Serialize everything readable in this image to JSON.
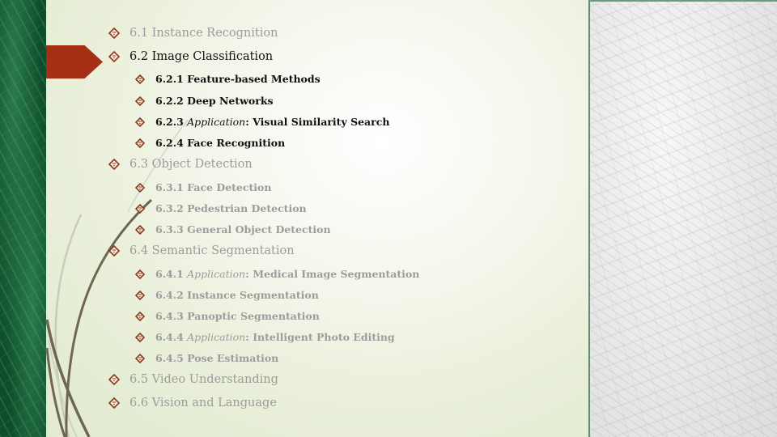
{
  "theme": {
    "accent": "#a52f14",
    "bullet_color": "#8a3a1c",
    "active_text": "#111111",
    "inactive_text": "#9c9c9c",
    "green_strip": "#0d4d2a",
    "curve_color": "#6e6650"
  },
  "outline": [
    {
      "level": 1,
      "number": "6.1",
      "italic": "",
      "text": "Instance Recognition",
      "active": false
    },
    {
      "level": 1,
      "number": "6.2",
      "italic": "",
      "text": "Image Classification",
      "active": true
    },
    {
      "level": 2,
      "number": "6.2.1",
      "italic": "",
      "text": "Feature-based Methods",
      "active": true
    },
    {
      "level": 2,
      "number": "6.2.2",
      "italic": "",
      "text": "Deep Networks",
      "active": true
    },
    {
      "level": 2,
      "number": "6.2.3",
      "italic": "Application",
      "text": ": Visual Similarity Search",
      "active": true
    },
    {
      "level": 2,
      "number": "6.2.4",
      "italic": "",
      "text": "Face Recognition",
      "active": true
    },
    {
      "level": 1,
      "number": "6.3",
      "italic": "",
      "text": "Object Detection",
      "active": false
    },
    {
      "level": 2,
      "number": "6.3.1",
      "italic": "",
      "text": "Face Detection",
      "active": false
    },
    {
      "level": 2,
      "number": "6.3.2",
      "italic": "",
      "text": "Pedestrian Detection",
      "active": false
    },
    {
      "level": 2,
      "number": "6.3.3",
      "italic": "",
      "text": "General Object Detection",
      "active": false
    },
    {
      "level": 1,
      "number": "6.4",
      "italic": "",
      "text": "Semantic Segmentation",
      "active": false
    },
    {
      "level": 2,
      "number": "6.4.1",
      "italic": "Application",
      "text": ": Medical Image Segmentation",
      "active": false
    },
    {
      "level": 2,
      "number": "6.4.2",
      "italic": "",
      "text": "Instance Segmentation",
      "active": false
    },
    {
      "level": 2,
      "number": "6.4.3",
      "italic": "",
      "text": "Panoptic Segmentation",
      "active": false
    },
    {
      "level": 2,
      "number": "6.4.4",
      "italic": "Application",
      "text": ": Intelligent Photo Editing",
      "active": false
    },
    {
      "level": 2,
      "number": "6.4.5",
      "italic": "",
      "text": "Pose Estimation",
      "active": false
    },
    {
      "level": 1,
      "number": "6.5",
      "italic": "",
      "text": "Video Understanding",
      "active": false
    },
    {
      "level": 1,
      "number": "6.6",
      "italic": "",
      "text": "Vision and Language",
      "active": false
    }
  ],
  "icons": {
    "bullet": "diamond-bullet-icon",
    "current_marker": "arrow-marker-icon"
  }
}
